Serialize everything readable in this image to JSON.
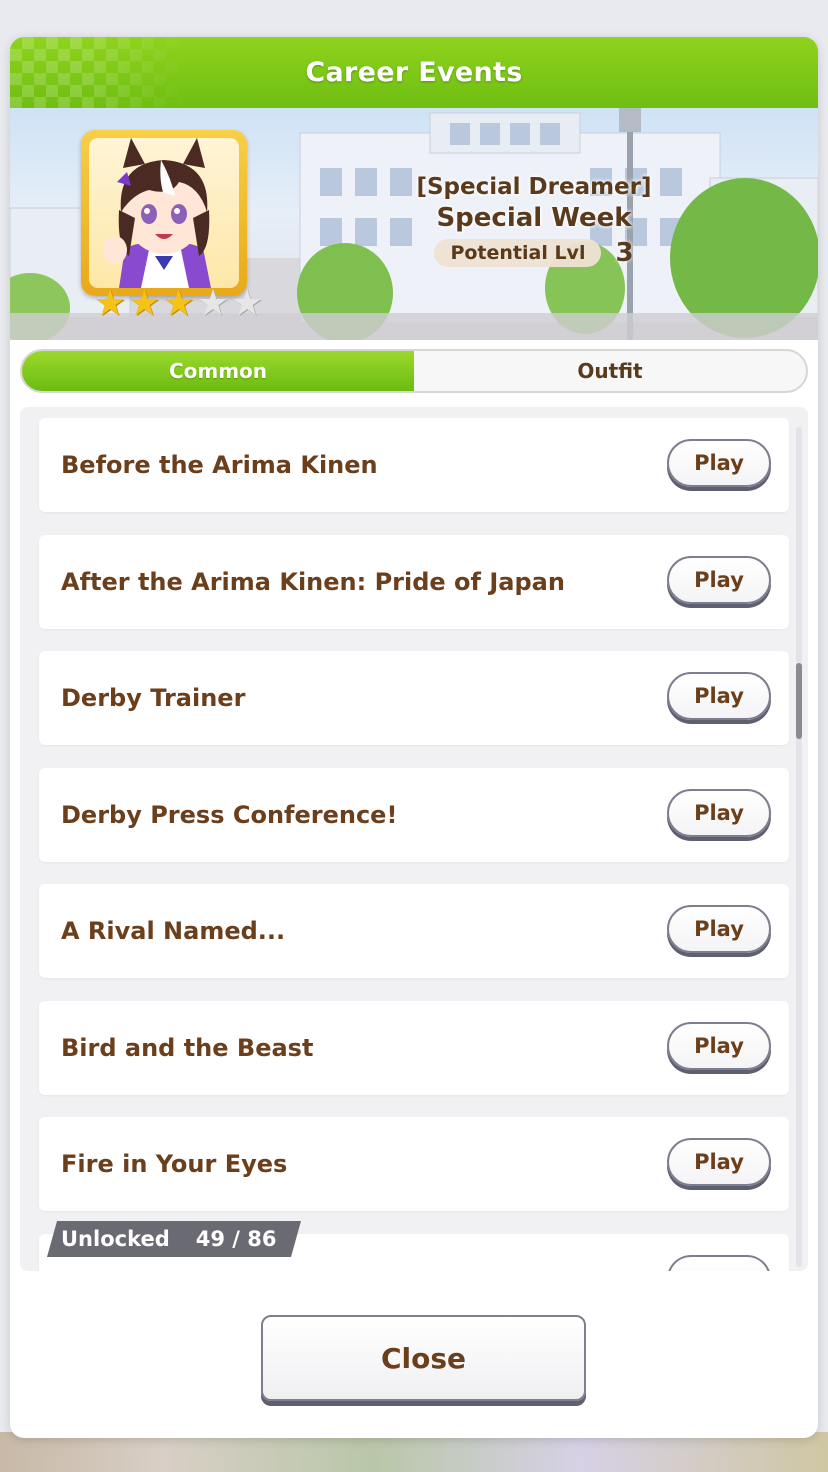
{
  "dialog": {
    "title": "Career Events"
  },
  "character": {
    "epithet": "[Special Dreamer]",
    "name": "Special Week",
    "potential_label": "Potential Lvl",
    "potential_value": "3",
    "stars_filled": 3,
    "stars_total": 5
  },
  "tabs": [
    {
      "label": "Common",
      "active": true
    },
    {
      "label": "Outfit",
      "active": false
    }
  ],
  "events": [
    {
      "title": "Before the Arima Kinen",
      "button": "Play"
    },
    {
      "title": "After the Arima Kinen: Pride of Japan",
      "button": "Play"
    },
    {
      "title": "Derby Trainer",
      "button": "Play"
    },
    {
      "title": "Derby Press Conference!",
      "button": "Play"
    },
    {
      "title": "A Rival Named...",
      "button": "Play"
    },
    {
      "title": "Bird and the Beast",
      "button": "Play"
    },
    {
      "title": "Fire in Your Eyes",
      "button": "Play"
    }
  ],
  "unlocked": {
    "label": "Unlocked",
    "count": "49 / 86"
  },
  "close_label": "Close",
  "colors": {
    "header_green": "#7ac617",
    "text_brown": "#6b3e1c",
    "star_gold": "#f5c21a"
  }
}
